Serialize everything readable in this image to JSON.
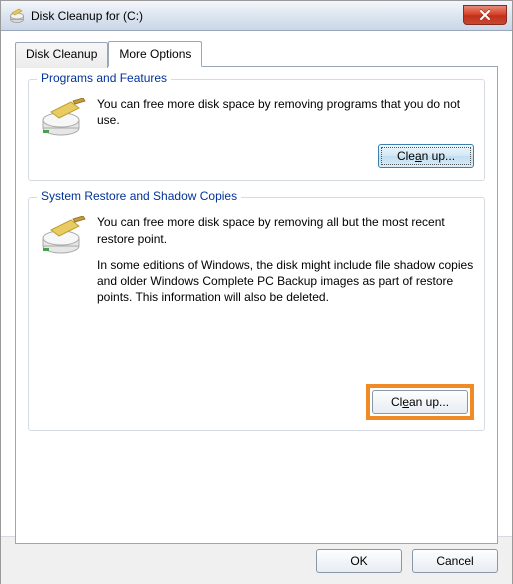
{
  "window": {
    "title": "Disk Cleanup for  (C:)"
  },
  "tabs": {
    "cleanup": "Disk Cleanup",
    "more": "More Options"
  },
  "groups": {
    "programs": {
      "legend": "Programs and Features",
      "text": "You can free more disk space by removing programs that you do not use.",
      "button_prefix": "Cle",
      "button_ul": "a",
      "button_suffix": "n up..."
    },
    "restore": {
      "legend": "System Restore and Shadow Copies",
      "text1": "You can free more disk space by removing all but the most recent restore point.",
      "text2": "In some editions of Windows, the disk might include file shadow copies and older Windows Complete PC Backup images as part of restore points. This information will also be deleted.",
      "button_prefix": "Cl",
      "button_ul": "e",
      "button_suffix": "an up..."
    }
  },
  "footer": {
    "ok": "OK",
    "cancel": "Cancel"
  }
}
